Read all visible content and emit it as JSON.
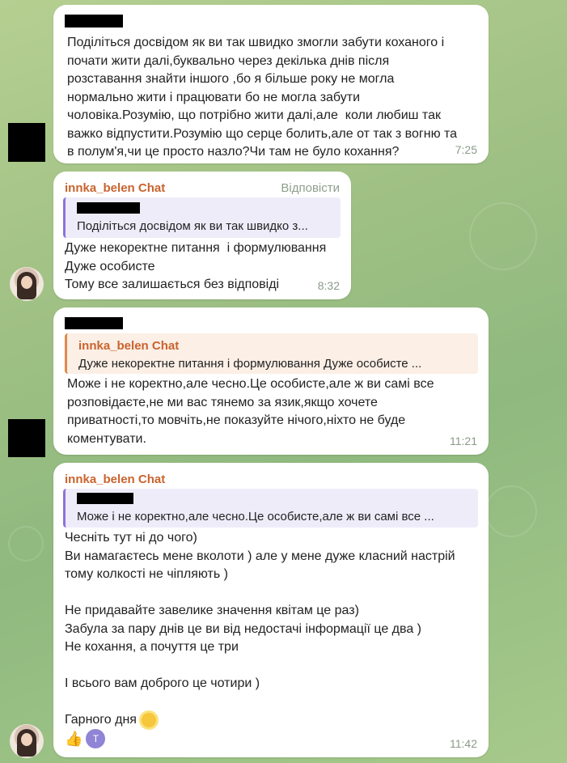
{
  "messages": [
    {
      "text": "Поділіться досвідом як ви так швидко змогли забути коханого і\nпочати жити далі,буквально через декілька днів після\nрозставання знайти іншого ,бо я більше року не могла\nнормально жити і працювати бо не могла забути\nчоловіка.Розумію, що потрібно жити далі,але  коли любиш так\nважко відпустити.Розумію що серце болить,але от так з вогню та\nв полум'я,чи це просто назло?Чи там не було кохання?",
      "time": "7:25"
    },
    {
      "sender": "innka_belen Chat",
      "reply_label": "Відповісти",
      "quote": "Поділіться досвідом як ви так швидко з...",
      "text": "Дуже некоректне питання  і формулювання\nДуже особисте\nТому все залишається без відповіді",
      "time": "8:32"
    },
    {
      "quote_sender": "innka_belen Chat",
      "quote": "Дуже некоректне питання  і формулювання  Дуже особисте  ...",
      "text": "Може і не коректно,але чесно.Це особисте,але ж ви самі все\nрозповідаєте,не ми вас тянемо за язик,якщо хочете\nприватності,то мовчіть,не показуйте нічого,ніхто не буде\nкоментувати.",
      "time": "11:21"
    },
    {
      "sender": "innka_belen Chat",
      "quote": "Може і не коректно,але чесно.Це особисте,але ж ви самі все ...",
      "text": "Чесніть тут ні до чого)\nВи намагаєтесь мене вколоти ) але у мене дуже класний настрій\nтому колкості не чіпляють )\n\nНе придавайте завелике значення квітам це раз)\nЗабула за пару днів це ви від недостачі інформації це два )\nНе кохання, а почуття це три\n\nІ всього вам доброго це чотири )\n\nГарного дня",
      "time": "11:42",
      "reactions": {
        "emoji": "👍",
        "avatar_letter": "T"
      }
    }
  ],
  "colors": {
    "sender": "#c9632d",
    "quote_purple": "#8d73d8",
    "quote_orange": "#e0894e"
  }
}
